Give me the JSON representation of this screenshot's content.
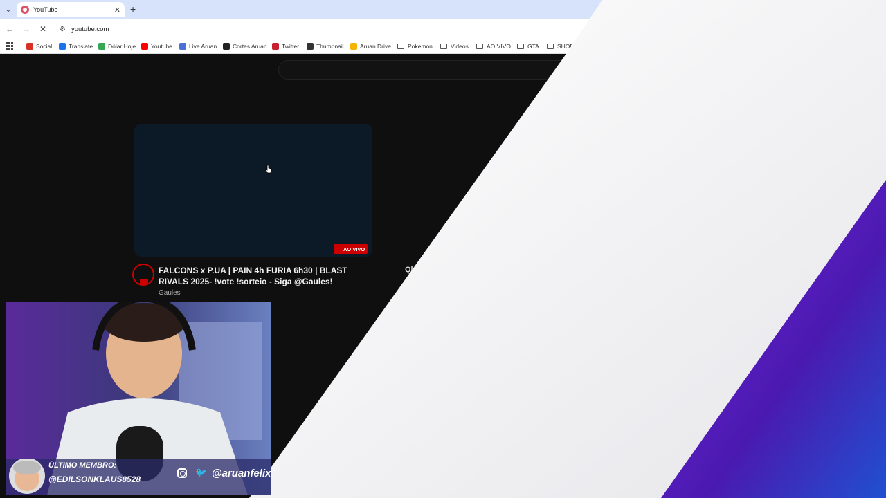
{
  "tab": {
    "title": "YouTube",
    "close": "✕",
    "new_tab": "+"
  },
  "toolbar": {
    "url": "youtube.com"
  },
  "bookmarks": [
    {
      "label": "Social",
      "color": "#d93025"
    },
    {
      "label": "Translate",
      "color": "#1a73e8"
    },
    {
      "label": "Dólar Hoje",
      "color": "#34a853"
    },
    {
      "label": "Youtube",
      "color": "#ff0000"
    },
    {
      "label": "Live Aruan",
      "color": "#4a6fd6"
    },
    {
      "label": "Cortes Aruan",
      "color": "#222222"
    },
    {
      "label": "Twitter",
      "color": "#c8202f"
    },
    {
      "label": "Thumbnail",
      "color": "#333333"
    },
    {
      "label": "Aruan Drive",
      "color": "#f4b400"
    }
  ],
  "bookmark_folders": [
    "Pokemon",
    "Videos",
    "AO VIVO",
    "GTA",
    "SHOP"
  ],
  "video": {
    "live_badge": "AO VIVO",
    "title": "FALCONS x P.UA | PAIN 4h FURIA 6h30 | BLAST RIVALS 2025- !vote !sorteio - Siga @Gaules!",
    "channel": "Gaules",
    "partial_next": "Ql"
  },
  "webcam": {
    "member_label": "ÚLTIMO MEMBRO:",
    "member_name": "@EDILSONKLAUS8528",
    "social_handle": "@aruanfelix"
  },
  "colors": {
    "accent_red": "#cc0000",
    "overlay_purple": "#6a1fd0",
    "tabstrip": "#d7e3fb"
  }
}
